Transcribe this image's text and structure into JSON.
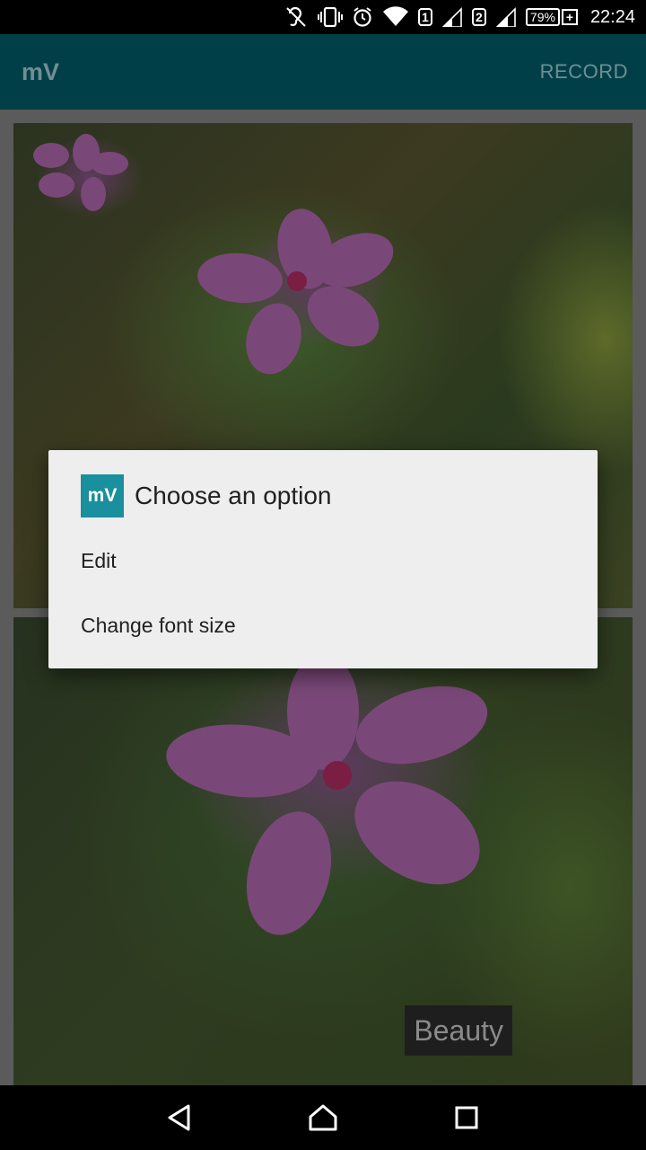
{
  "status_bar": {
    "sim1": "1",
    "sim2": "2",
    "battery": "79%",
    "time": "22:24",
    "icons": [
      "hearing-aid-icon",
      "vibrate-icon",
      "alarm-icon",
      "wifi-icon",
      "signal-icon",
      "battery-charging-icon"
    ]
  },
  "app_bar": {
    "title": "mV",
    "action": "RECORD"
  },
  "content": {
    "caption": "Beauty"
  },
  "dialog": {
    "icon_text": "mV",
    "title": "Choose an option",
    "options": [
      {
        "label": "Edit"
      },
      {
        "label": "Change font size"
      }
    ]
  },
  "nav_bar": {
    "buttons": [
      "back-icon",
      "home-icon",
      "recents-icon"
    ]
  },
  "colors": {
    "app_bar": "#013f48",
    "dialog_icon": "#1a8f9e",
    "dialog_bg": "#eeeeee"
  }
}
